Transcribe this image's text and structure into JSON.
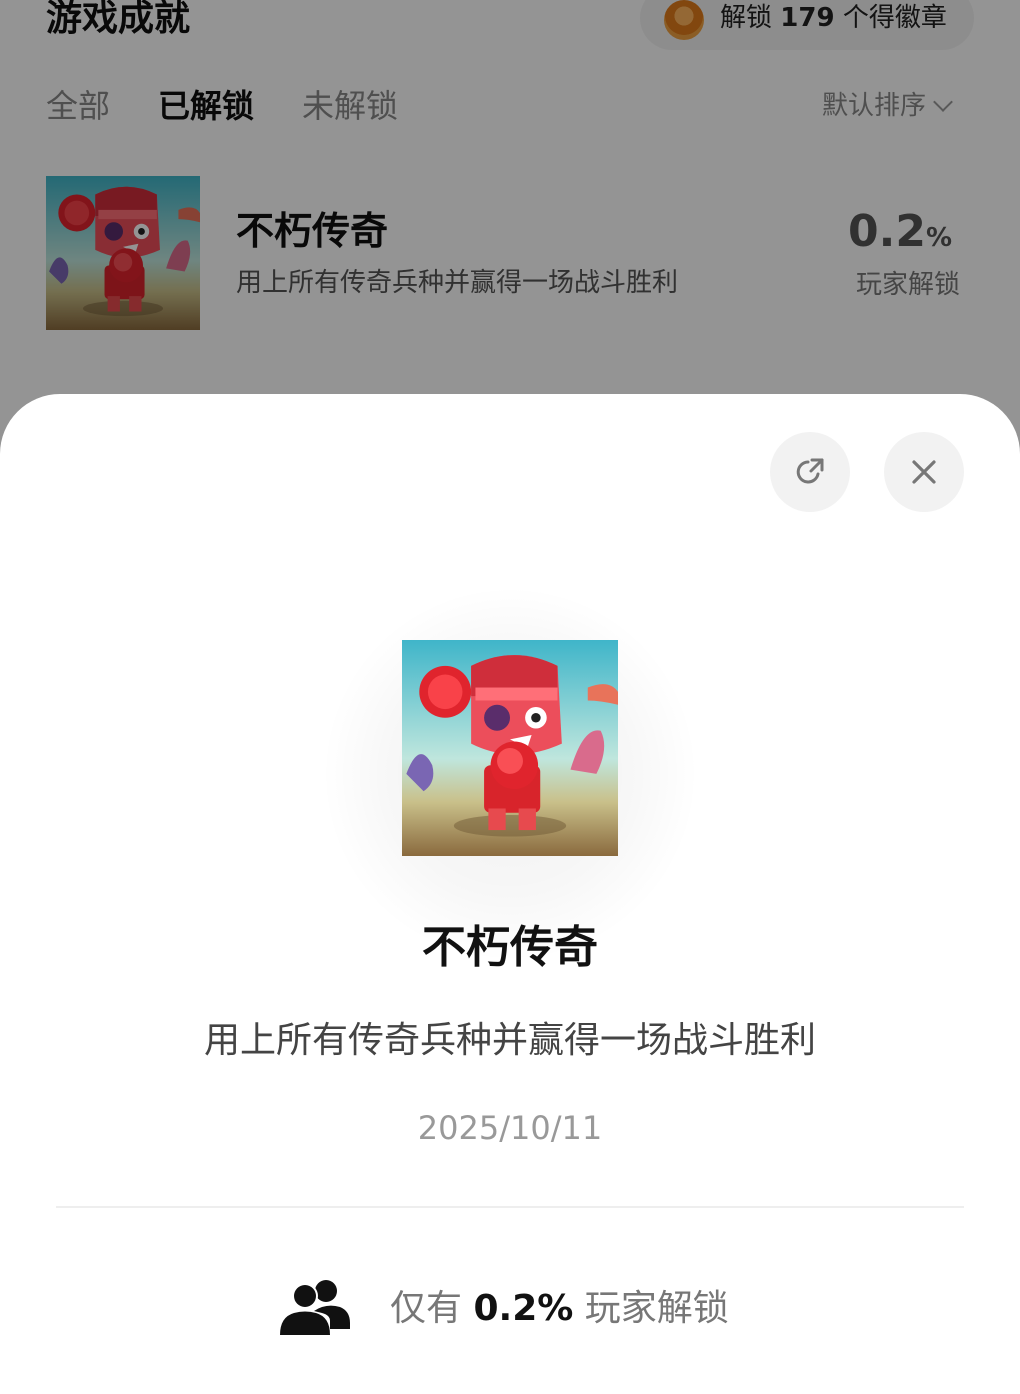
{
  "header": {
    "title": "游戏成就",
    "badge_prefix": "解锁",
    "badge_count": "179",
    "badge_suffix": "个得徽章"
  },
  "tabs": [
    {
      "label": "全部",
      "active": false
    },
    {
      "label": "已解锁",
      "active": true
    },
    {
      "label": "未解锁",
      "active": false
    }
  ],
  "sort": {
    "label": "默认排序"
  },
  "achievement_row": {
    "name": "不朽传奇",
    "description": "用上所有传奇兵种并赢得一场战斗胜利",
    "percent_value": "0.2",
    "percent_unit": "%",
    "percent_label": "玩家解锁"
  },
  "sheet": {
    "name": "不朽传奇",
    "description": "用上所有传奇兵种并赢得一场战斗胜利",
    "date": "2025/10/11",
    "stat_prefix": "仅有",
    "stat_value": "0.2%",
    "stat_suffix": "玩家解锁"
  },
  "icons": {
    "share": "share-icon",
    "close": "close-icon",
    "people": "people-icon",
    "sort_chevron": "chevron-down-icon"
  },
  "colors": {
    "overlay": "rgba(0,0,0,0.42)",
    "sheet_bg": "#ffffff",
    "button_bg": "#f2f2f2",
    "badge_orange": "#e07b1a"
  }
}
